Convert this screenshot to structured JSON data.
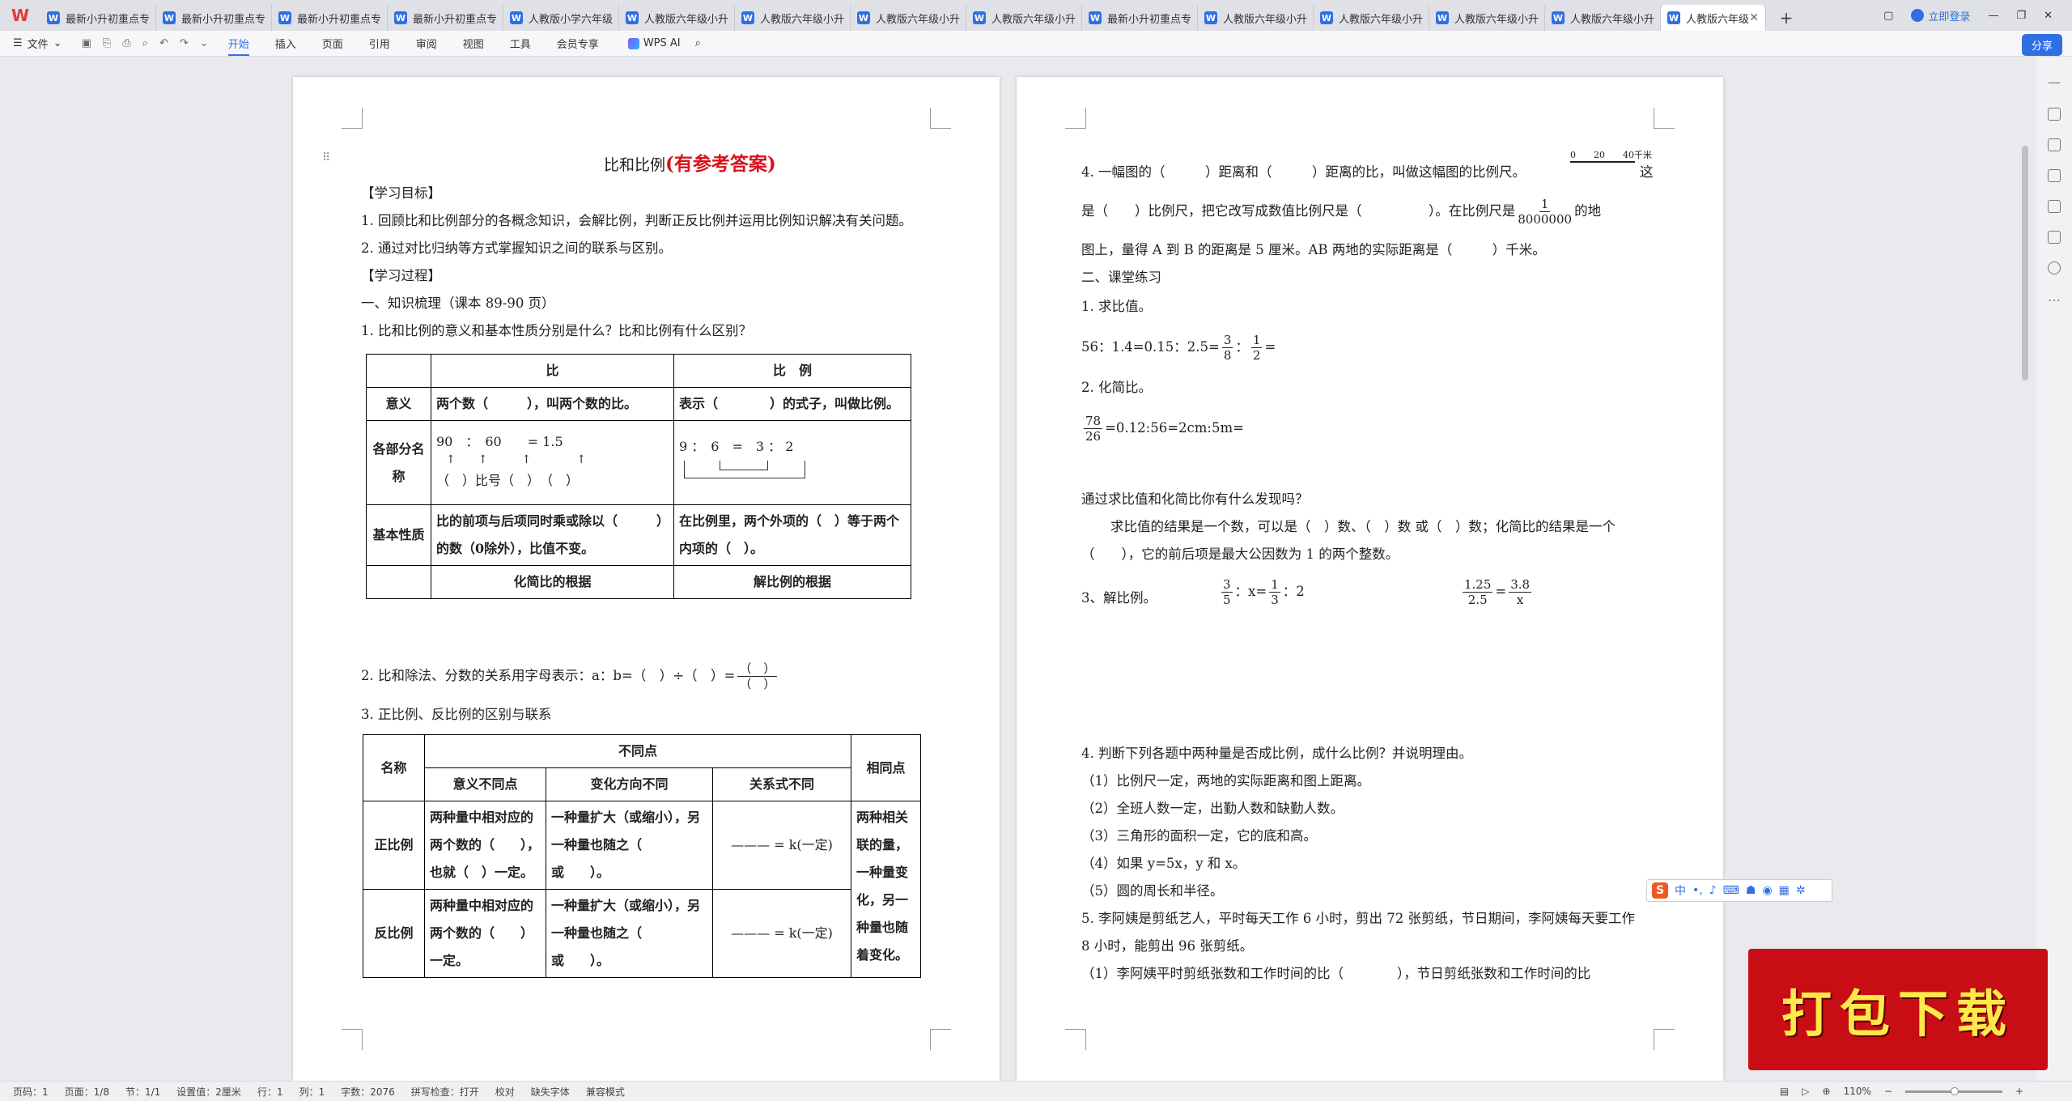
{
  "tabs": [
    {
      "label": "最新小升初重点专"
    },
    {
      "label": "最新小升初重点专"
    },
    {
      "label": "最新小升初重点专"
    },
    {
      "label": "最新小升初重点专"
    },
    {
      "label": "人教版小学六年级"
    },
    {
      "label": "人教版六年级小升"
    },
    {
      "label": "人教版六年级小升"
    },
    {
      "label": "人教版六年级小升"
    },
    {
      "label": "人教版六年级小升"
    },
    {
      "label": "最新小升初重点专"
    },
    {
      "label": "人教版六年级小升"
    },
    {
      "label": "人教版六年级小升"
    },
    {
      "label": "人教版六年级小升"
    },
    {
      "label": "人教版六年级小升"
    },
    {
      "label": "人教版六年级"
    }
  ],
  "titlebar": {
    "login": "立即登录"
  },
  "toolbar": {
    "file": "文件",
    "menu": [
      "开始",
      "插入",
      "页面",
      "引用",
      "审阅",
      "视图",
      "工具",
      "会员专享"
    ],
    "wps_ai": "WPS AI",
    "share": "分享"
  },
  "page1": {
    "title": "比和比例",
    "title_red": "(有参考答案)",
    "lines": [
      "【学习目标】",
      "1. 回顾比和比例部分的各概念知识，会解比例，判断正反比例并运用比例知识解决有关问题。",
      "2. 通过对比归纳等方式掌握知识之间的联系与区别。",
      "【学习过程】",
      "一、知识梳理（课本 89-90 页）",
      "1. 比和比例的意义和基本性质分别是什么？比和比例有什么区别？"
    ],
    "t1": {
      "h_bi": "比",
      "h_bili": "比　例",
      "r1_label": "意义",
      "r1_bi": "两个数（　　　），叫两个数的比。",
      "r1_bili": "表示（　　　　）的式子，叫做比例。",
      "r2_label": "各部分名称",
      "r2_bi_top": "90　：　60　　= 1.5",
      "r2_bi_bottom": "（　）比号（　）　（　）",
      "r2_bili_top": "9 ：　6　=　3 ： 2",
      "r3_label": "基本性质",
      "r3_bi": "比的前项与后项同时乘或除以（　　　）的数（0除外），比值不变。",
      "r3_bili": "在比例里，两个外项的（　）等于两个内项的（　）。",
      "r4_bi": "化简比的根据",
      "r4_bili": "解比例的根据"
    },
    "q2": "2. 比和除法、分数的关系用字母表示：a：b=（　）÷（　）=",
    "q2_frac_top": "（　）",
    "q2_frac_bottom": "（　）",
    "q3": "3. 正比例、反比例的区别与联系",
    "t2": {
      "h_name": "名称",
      "h_diff": "不同点",
      "h_same": "相同点",
      "h_meaning": "意义不同点",
      "h_change": "变化方向不同",
      "h_formula": "关系式不同",
      "zheng": "正比例",
      "zheng_meaning": "两种量中相对应的两个数的（　　），也就（　）一定。",
      "zheng_change": "一种量扩大（或缩小），另一种量也随之（　　或　　）。",
      "zheng_formula": "——— = k(一定)",
      "fan": "反比例",
      "fan_meaning": "两种量中相对应的两个数的（　　）一定。",
      "fan_change": "一种量扩大（或缩小），另一种量也随之（　　或　　）。",
      "fan_formula": "——— = k(一定)",
      "same": "两种相关联的量，一种量变化，另一种量也随着变化。"
    }
  },
  "page2": {
    "l1": "4. 一幅图的（　　　）距离和（　　　）距离的比，叫做这幅图的比例尺。",
    "l1_end": "这",
    "scale_labels": "0　　20　　40千米",
    "l2": "是（　　）比例尺，把它改写成数值比例尺是（　　　　　）。在比例尺是",
    "l2_frac_top": "1",
    "l2_frac_bottom": "8000000",
    "l2_end": "的地",
    "l3": "图上，量得 A 到 B 的距离是 5 厘米。AB 两地的实际距离是（　　　）千米。",
    "l4": "二、课堂练习",
    "l5": "1. 求比值。",
    "l6": "56：1.4=0.15：2.5=",
    "l7": "2. 化简比。",
    "l8": "=0.12:56=2cm:5m=",
    "l8_frac_top": "78",
    "l8_frac_bottom": "26",
    "l9": "通过求比值和化简比你有什么发现吗？",
    "l10": "求比值的结果是一个数，可以是（　）数、（　）数 或（　）数；化简比的结果是一个",
    "l11": "（　　），它的前后项是最大公因数为 1 的两个整数。",
    "l12": "3、解比例。",
    "l12_a": "x=",
    "l12_b": "：2",
    "l12_c": "=",
    "l13": "4. 判断下列各题中两种量是否成比例，成什么比例？并说明理由。",
    "l14": "（1）比例尺一定，两地的实际距离和图上距离。",
    "l15": "（2）全班人数一定，出勤人数和缺勤人数。",
    "l16": "（3）三角形的面积一定，它的底和高。",
    "l17": "（4）如果 y=5x，y 和 x。",
    "l18": "（5）圆的周长和半径。",
    "l19": "5. 李阿姨是剪纸艺人，平时每天工作 6 小时，剪出 72 张剪纸，节日期间，李阿姨每天要工作",
    "l20": "8 小时，能剪出 96 张剪纸。",
    "l21": "（1）李阿姨平时剪纸张数和工作时间的比（　　　　），节日剪纸张数和工作时间的比"
  },
  "ime": {
    "label": "中"
  },
  "promo": {
    "text": "打包下载"
  },
  "status": {
    "items": [
      "页码：1",
      "页面：1/8",
      "节：1/1",
      "设置值：2厘米",
      "行：1",
      "列：1",
      "字数：2076",
      "拼写检查：打开",
      "校对",
      "缺失字体",
      "兼容模式"
    ],
    "zoom": "110%"
  }
}
